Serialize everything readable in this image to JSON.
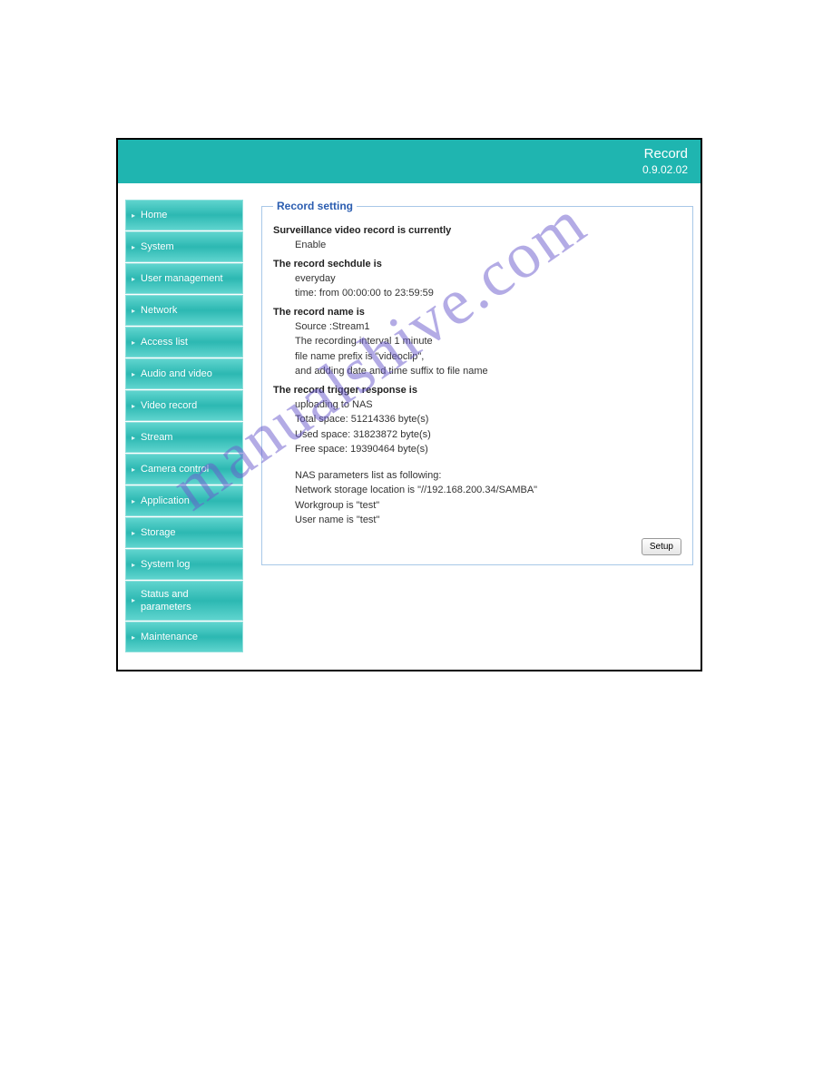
{
  "header": {
    "title": "Record",
    "version": "0.9.02.02"
  },
  "sidebar": {
    "items": [
      "Home",
      "System",
      "User management",
      "Network",
      "Access list",
      "Audio and video",
      "Video record",
      "Stream",
      "Camera control",
      "Application",
      "Storage",
      "System log",
      "Status and parameters",
      "Maintenance"
    ]
  },
  "panel": {
    "legend": "Record setting",
    "setup_button": "Setup",
    "sec1_title": "Surveillance video record is currently",
    "sec1_l1": "Enable",
    "sec2_title": "The record sechdule is",
    "sec2_l1": "everyday",
    "sec2_l2": "time: from 00:00:00 to 23:59:59",
    "sec3_title": "The record name is",
    "sec3_l1": "Source :Stream1",
    "sec3_l2": "The recording interval 1 minute",
    "sec3_l3": "file name prefix is \"videoclip\",",
    "sec3_l4": "and adding date and time suffix to file name",
    "sec4_title": "The record trigger response is",
    "sec4_l1": "uploading to NAS",
    "sec4_l2": "Total space: 51214336 byte(s)",
    "sec4_l3": "Used space: 31823872 byte(s)",
    "sec4_l4": "Free space: 19390464 byte(s)",
    "sec4_l5": "NAS parameters list as following:",
    "sec4_l6": "Network storage location is \"//192.168.200.34/SAMBA\"",
    "sec4_l7": "Workgroup is \"test\"",
    "sec4_l8": "User name is \"test\""
  },
  "watermark": "manualshive.com"
}
